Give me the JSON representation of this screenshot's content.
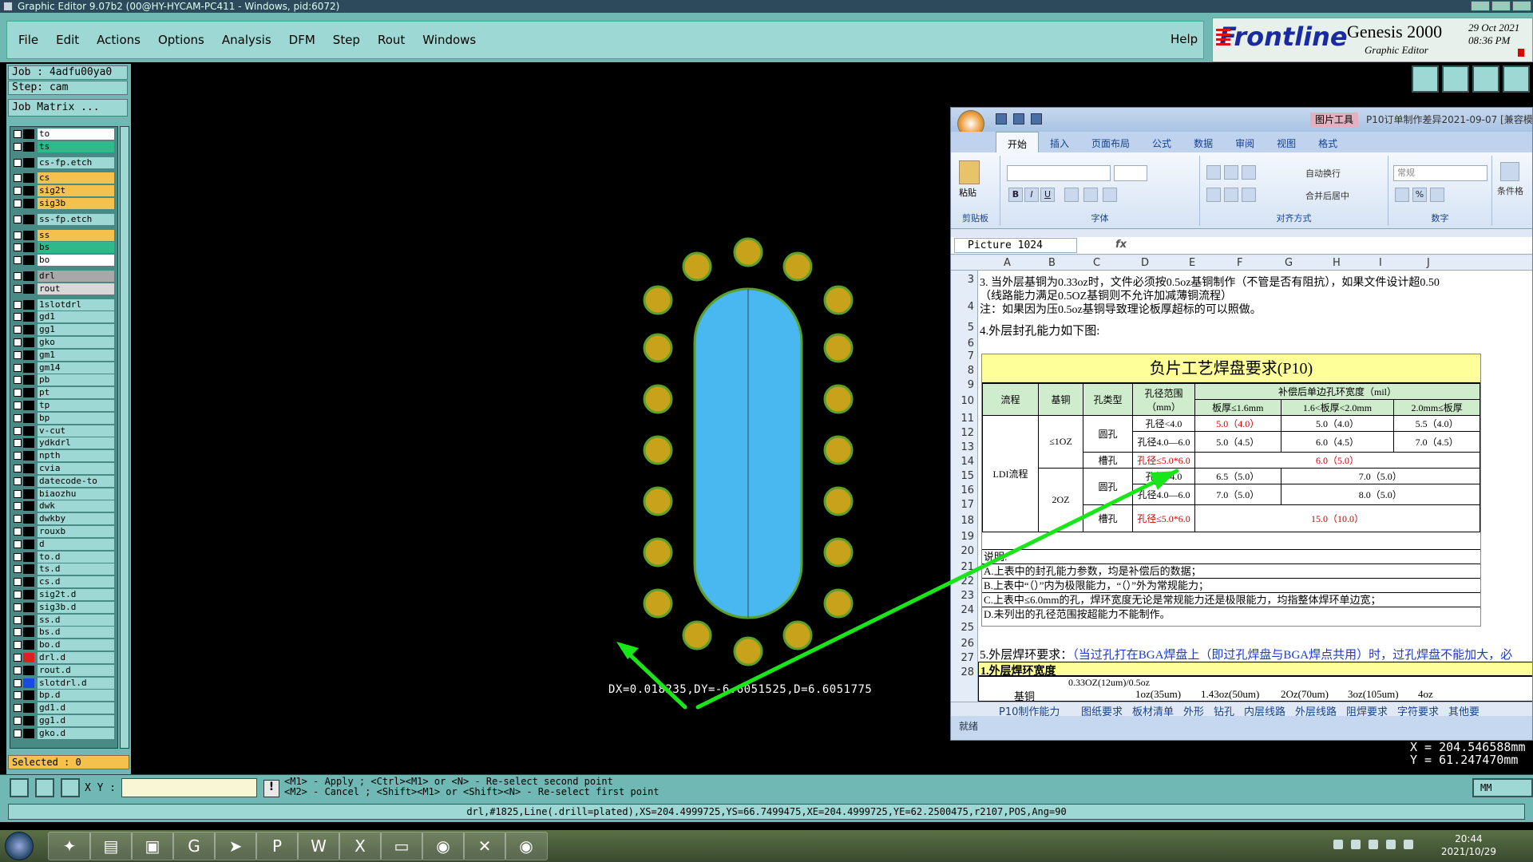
{
  "window": {
    "title": "Graphic Editor 9.07b2 (00@HY-HYCAM-PC411 - Windows, pid:6072)"
  },
  "menu": {
    "items": [
      "File",
      "Edit",
      "Actions",
      "Options",
      "Analysis",
      "DFM",
      "Step",
      "Rout",
      "Windows"
    ],
    "help": "Help"
  },
  "brand": {
    "logo": "Frontline",
    "product": "Genesis 2000",
    "subtitle": "Graphic Editor",
    "date": "29 Oct 2021",
    "time": "08:36 PM"
  },
  "job": {
    "job": "Job : 4adfu00ya0",
    "step": "Step: cam",
    "matrix": "Job Matrix ..."
  },
  "layers": [
    {
      "name": "to",
      "color": "#ffffff"
    },
    {
      "name": "ts",
      "color": "#2fb88a"
    },
    {
      "name": "cs-fp.etch",
      "color": "#9ed8d4"
    },
    {
      "name": "cs",
      "color": "#f4c24c"
    },
    {
      "name": "sig2t",
      "color": "#f4c24c"
    },
    {
      "name": "sig3b",
      "color": "#f4c24c"
    },
    {
      "name": "ss-fp.etch",
      "color": "#9ed8d4"
    },
    {
      "name": "ss",
      "color": "#f4c24c"
    },
    {
      "name": "bs",
      "color": "#2fb88a"
    },
    {
      "name": "bo",
      "color": "#ffffff"
    },
    {
      "name": "drl",
      "color": "#a8a8a8"
    },
    {
      "name": "rout",
      "color": "#d8d8d8"
    },
    {
      "name": "1slotdrl",
      "color": "#9ed8d4"
    },
    {
      "name": "gd1",
      "color": "#9ed8d4"
    },
    {
      "name": "gg1",
      "color": "#9ed8d4"
    },
    {
      "name": "gko",
      "color": "#9ed8d4"
    },
    {
      "name": "gm1",
      "color": "#9ed8d4"
    },
    {
      "name": "gm14",
      "color": "#9ed8d4"
    },
    {
      "name": "pb",
      "color": "#9ed8d4"
    },
    {
      "name": "pt",
      "color": "#9ed8d4"
    },
    {
      "name": "tp",
      "color": "#9ed8d4"
    },
    {
      "name": "bp",
      "color": "#9ed8d4"
    },
    {
      "name": "v-cut",
      "color": "#9ed8d4"
    },
    {
      "name": "ydkdrl",
      "color": "#9ed8d4"
    },
    {
      "name": "npth",
      "color": "#9ed8d4"
    },
    {
      "name": "cvia",
      "color": "#9ed8d4"
    },
    {
      "name": "datecode-to",
      "color": "#9ed8d4"
    },
    {
      "name": "biaozhu",
      "color": "#9ed8d4"
    },
    {
      "name": "dwk",
      "color": "#9ed8d4"
    },
    {
      "name": "dwkby",
      "color": "#9ed8d4"
    },
    {
      "name": "rouxb",
      "color": "#9ed8d4"
    },
    {
      "name": "d",
      "color": "#9ed8d4"
    },
    {
      "name": "to.d",
      "color": "#9ed8d4"
    },
    {
      "name": "ts.d",
      "color": "#9ed8d4"
    },
    {
      "name": "cs.d",
      "color": "#9ed8d4"
    },
    {
      "name": "sig2t.d",
      "color": "#9ed8d4"
    },
    {
      "name": "sig3b.d",
      "color": "#9ed8d4"
    },
    {
      "name": "ss.d",
      "color": "#9ed8d4"
    },
    {
      "name": "bs.d",
      "color": "#9ed8d4"
    },
    {
      "name": "bo.d",
      "color": "#9ed8d4"
    },
    {
      "name": "drl.d",
      "color": "#9ed8d4",
      "swatch": "#e02020"
    },
    {
      "name": "rout.d",
      "color": "#9ed8d4"
    },
    {
      "name": "slotdrl.d",
      "color": "#9ed8d4",
      "swatch": "#1a4adf"
    },
    {
      "name": "bp.d",
      "color": "#9ed8d4"
    },
    {
      "name": "gd1.d",
      "color": "#9ed8d4"
    },
    {
      "name": "gg1.d",
      "color": "#9ed8d4"
    },
    {
      "name": "gko.d",
      "color": "#9ed8d4"
    }
  ],
  "selected": "Selected : 0",
  "canvas": {
    "measure": "DX=0.018235,DY=-6.6051525,D=6.6051775",
    "pad_color": "#c8a21a",
    "slot_color": "#4ab8f0"
  },
  "coords": {
    "x": "X = 204.546588mm",
    "y": "Y = 61.247470mm"
  },
  "excel": {
    "tool_tab": "图片工具",
    "doc_title": "P10订单制作差异2021-09-07 [兼容模",
    "tabs": [
      "开始",
      "插入",
      "页面布局",
      "公式",
      "数据",
      "审阅",
      "视图",
      "格式"
    ],
    "groups": {
      "clipboard": "剪贴板",
      "font": "字体",
      "align": "对齐方式",
      "number": "数字",
      "paste": "粘贴",
      "wrap": "自动换行",
      "merge": "合并后居中",
      "numfmt": "常规",
      "cond": "条件格"
    },
    "name_box": "Picture 1024",
    "fx": "fx",
    "columns": [
      "A",
      "B",
      "C",
      "D",
      "E",
      "F",
      "G",
      "H",
      "I",
      "J"
    ],
    "rows": [
      "3",
      "4",
      "5",
      "6",
      "7",
      "8",
      "9",
      "10",
      "11",
      "12",
      "13",
      "14",
      "15",
      "16",
      "17",
      "18",
      "19",
      "20",
      "21",
      "22",
      "23",
      "24",
      "25",
      "26",
      "27",
      "28"
    ],
    "line3": "3. 当外层基铜为0.33oz时，文件必须按0.5oz基铜制作（不管是否有阻抗），如果文件设计超0.50",
    "line3b": "（线路能力满足0.5OZ基铜则不允许加减薄铜流程）",
    "line4": "注：如果因为压0.5oz基铜导致理论板厚超标的可以照做。",
    "line5": "4.外层封孔能力如下图:",
    "table_title": "负片工艺焊盘要求(P10)",
    "hdr": [
      "流程",
      "基铜",
      "孔类型",
      "孔径范围（mm）",
      "补偿后单边孔环宽度（mil）",
      "板厚≤1.6mm",
      "1.6<板厚<2.0mm",
      "2.0mm≤板厚"
    ],
    "ldi": "LDI流程",
    "cu1": "≤1OZ",
    "cu2": "2OZ",
    "round": "圆孔",
    "slot": "槽孔",
    "r1": [
      "孔径<4.0",
      "5.0（4.0）",
      "5.0（4.0）",
      "5.5（4.0）"
    ],
    "r2": [
      "孔径4.0—6.0",
      "5.0（4.5）",
      "6.0（4.5）",
      "7.0（4.5）"
    ],
    "r3": [
      "孔径≤5.0*6.0",
      "6.0（5.0）"
    ],
    "r4": [
      "孔径<4.0",
      "6.5（5.0）",
      "7.0（5.0）"
    ],
    "r5": [
      "孔径4.0—6.0",
      "7.0（5.0）",
      "8.0（5.0）"
    ],
    "r6": [
      "孔径≤5.0*6.0",
      "15.0（10.0）"
    ],
    "notes": [
      "说明:",
      "A.上表中的封孔能力参数，均是补偿后的数据；",
      "B.上表中“（）”内为极限能力，“（）”外为常规能力；",
      "C.上表中≤6.0mm的孔，焊环宽度无论是常规能力还是极限能力，均指整体焊环单边宽；",
      "D.未列出的孔径范围按超能力不能制作。"
    ],
    "line25": "5.外层焊环要求：",
    "line25b": "（当过孔打在BGA焊盘上（即过孔焊盘与BGA焊点共用）时，过孔焊盘不能加大，必",
    "line26": "1.外层焊环宽度",
    "row27": [
      "基铜",
      "0.33OZ(12um)/0.5oz",
      "1oz(35um)",
      "1.43oz(50um)",
      "2Oz(70um)",
      "3oz(105um)",
      "4oz"
    ],
    "sheet_tabs": [
      "P10制作能力",
      "图纸要求",
      "板材清单",
      "外形",
      "钻孔",
      "内层线路",
      "外层线路",
      "阻焊要求",
      "字符要求",
      "其他要"
    ],
    "status": "就绪"
  },
  "cmd": {
    "xy_label": "X Y :",
    "xy_value": "",
    "bang": "!",
    "hint1": "<M1> - Apply  ; <Ctrl><M1> or <N> - Re-select second point",
    "hint2": "<M2> - Cancel ; <Shift><M1> or <Shift><N> - Re-select first point",
    "unit": "MM"
  },
  "status": "drl,#1825,Line(.drill=plated),XS=204.4999725,YS=66.7499475,XE=204.4999725,YE=62.2500475,r2107,POS,Ang=90",
  "taskbar": {
    "time": "20:44",
    "date": "2021/10/29",
    "icons": [
      "folder-icon",
      "notepad-icon",
      "save-icon",
      "app-g-icon",
      "feather-icon",
      "p-icon",
      "word-icon",
      "excel-icon",
      "paper-icon",
      "eye-icon",
      "x-icon",
      "eye2-icon"
    ]
  },
  "annotation": {
    "arrow_color": "#19e619"
  }
}
